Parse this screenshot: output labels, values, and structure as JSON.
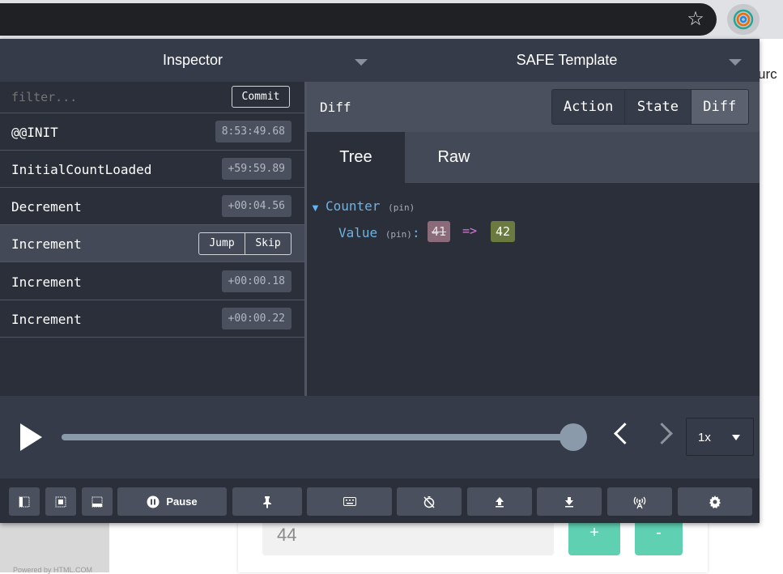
{
  "devtools": {
    "monitors": [
      {
        "label": "Inspector"
      },
      {
        "label": "SAFE Template"
      }
    ],
    "filter": {
      "placeholder": "filter...",
      "value": ""
    },
    "commit_label": "Commit",
    "actions": [
      {
        "name": "@@INIT",
        "time": "8:53:49.68",
        "selected": false
      },
      {
        "name": "InitialCountLoaded",
        "time": "+59:59.89",
        "selected": false
      },
      {
        "name": "Decrement",
        "time": "+00:04.56",
        "selected": false
      },
      {
        "name": "Increment",
        "time": "",
        "selected": true
      },
      {
        "name": "Increment",
        "time": "+00:00.18",
        "selected": false
      },
      {
        "name": "Increment",
        "time": "+00:00.22",
        "selected": false
      }
    ],
    "jump_label": "Jump",
    "skip_label": "Skip",
    "detail": {
      "title": "Diff",
      "tabs": [
        "Action",
        "State",
        "Diff"
      ],
      "active_tab": "Diff",
      "subtabs": [
        "Tree",
        "Raw"
      ],
      "active_subtab": "Tree",
      "tree": {
        "root_key": "Counter",
        "root_pin": "(pin)",
        "child_key": "Value",
        "child_pin": "(pin)",
        "colon": ":",
        "old_value": "41",
        "arrow": "=>",
        "new_value": "42"
      }
    },
    "slider": {
      "progress": 1.0,
      "speed": "1x"
    },
    "toolbar": {
      "pause_label": "Pause",
      "icons": [
        "dock-left-icon",
        "dock-center-icon",
        "dock-bottom-icon",
        "pause-icon",
        "pin-icon",
        "keyboard-icon",
        "timer-off-icon",
        "upload-icon",
        "download-icon",
        "remote-icon",
        "gear-icon"
      ]
    }
  },
  "background_page": {
    "counter_value": "44",
    "plus_label": "+",
    "minus_label": "-",
    "side_text": "urc",
    "footer": "Powered by HTML.COM"
  },
  "colors": {
    "panel_bg": "#2a2f3a",
    "header_bg": "#353b48",
    "accent_blue": "#6fb3e0",
    "diff_old": "#8b6a7a",
    "diff_new": "#6b7a3e",
    "button_green": "#5fd0b2"
  }
}
